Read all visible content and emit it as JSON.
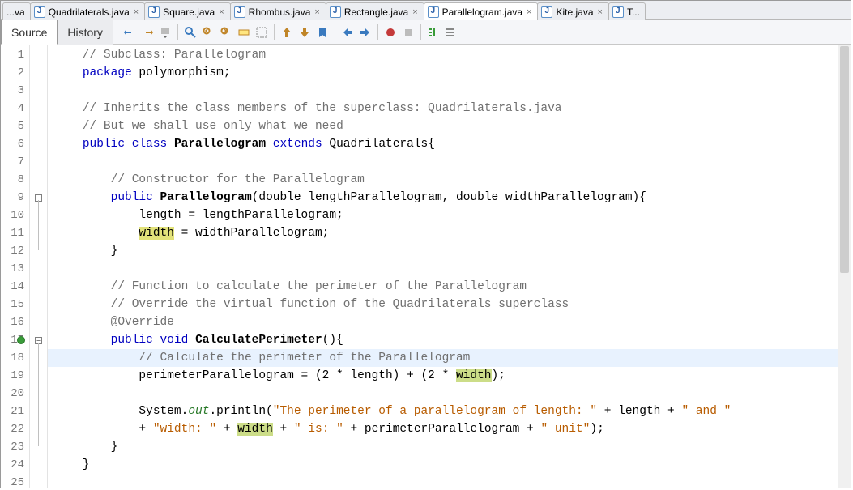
{
  "tabs": [
    {
      "label": "...va",
      "closeable": false,
      "hasIcon": false
    },
    {
      "label": "Quadrilaterals.java"
    },
    {
      "label": "Square.java"
    },
    {
      "label": "Rhombus.java"
    },
    {
      "label": "Rectangle.java"
    },
    {
      "label": "Parallelogram.java",
      "active": true
    },
    {
      "label": "Kite.java"
    },
    {
      "label": "T..."
    }
  ],
  "modes": {
    "source": "Source",
    "history": "History"
  },
  "toolbar": {
    "icons": [
      "last-edit",
      "forward",
      "dropdown",
      "sep",
      "find-selection",
      "find-prev",
      "find-next",
      "toggle-highlight",
      "toggle-rect",
      "sep",
      "prev-bookmark",
      "next-bookmark",
      "toggle-bookmark",
      "sep",
      "shift-left",
      "shift-right",
      "sep",
      "macro-record",
      "macro-play",
      "sep",
      "comment",
      "uncomment"
    ]
  },
  "glyph": {
    "close": "×"
  },
  "gutter": {
    "lines": [
      "1",
      "2",
      "3",
      "4",
      "5",
      "6",
      "7",
      "8",
      "9",
      "10",
      "11",
      "12",
      "13",
      "14",
      "15",
      "16",
      "17",
      "18",
      "19",
      "20",
      "21",
      "22",
      "23",
      "24",
      "25"
    ],
    "foldOpenAt": [
      9,
      17
    ],
    "foldRanges": [
      [
        9,
        12
      ],
      [
        17,
        23
      ]
    ],
    "overrideAt": 17,
    "highlightLine": 18
  },
  "code": {
    "l1": {
      "cm": "// Subclass: Parallelogram"
    },
    "l2": {
      "kw": "package",
      "rest": " polymorphism;"
    },
    "l4": {
      "cm": "// Inherits the class members of the superclass: Quadrilaterals.java"
    },
    "l5": {
      "cm": "// But we shall use only what we need"
    },
    "l6": {
      "kw1": "public",
      "kw2": "class",
      "name": "Parallelogram",
      "kw3": "extends",
      "sup": " Quadrilaterals{"
    },
    "l8": {
      "cm": "// Constructor for the Parallelogram"
    },
    "l9": {
      "kw": "public",
      "name": "Parallelogram",
      "sig": "(double lengthParallelogram, double widthParallelogram){"
    },
    "l10": {
      "txt1": "length = lengthParallelogram;"
    },
    "l11": {
      "mk": "width",
      "txt": " = widthParallelogram;"
    },
    "l12": {
      "txt": "}"
    },
    "l14": {
      "cm": "// Function to calculate the perimeter of the Parallelogram"
    },
    "l15": {
      "cm": "// Override the virtual function of the Quadrilaterals superclass"
    },
    "l16": {
      "ann": "@Override"
    },
    "l17": {
      "kw1": "public",
      "kw2": "void",
      "name": "CalculatePerimeter",
      "sig": "(){"
    },
    "l18": {
      "cm": "// Calculate the perimeter of the Parallelogram"
    },
    "l19": {
      "a": "perimeterParallelogram = (2 * length) + (2 * ",
      "mk": "width",
      "b": ");"
    },
    "l21": {
      "a": "System.",
      "out": "out",
      "b": ".println(",
      "s1": "\"The perimeter of a parallelogram of length: \"",
      "c": " + length + ",
      "s2": "\" and \""
    },
    "l22": {
      "a": "+ ",
      "s1": "\"width: \"",
      "b": " + ",
      "mk": "width",
      "c": " + ",
      "s2": "\" is: \"",
      "d": " + perimeterParallelogram + ",
      "s3": "\" unit\"",
      "e": ");"
    },
    "l23": {
      "txt": "}"
    },
    "l24": {
      "txt": "}"
    }
  }
}
